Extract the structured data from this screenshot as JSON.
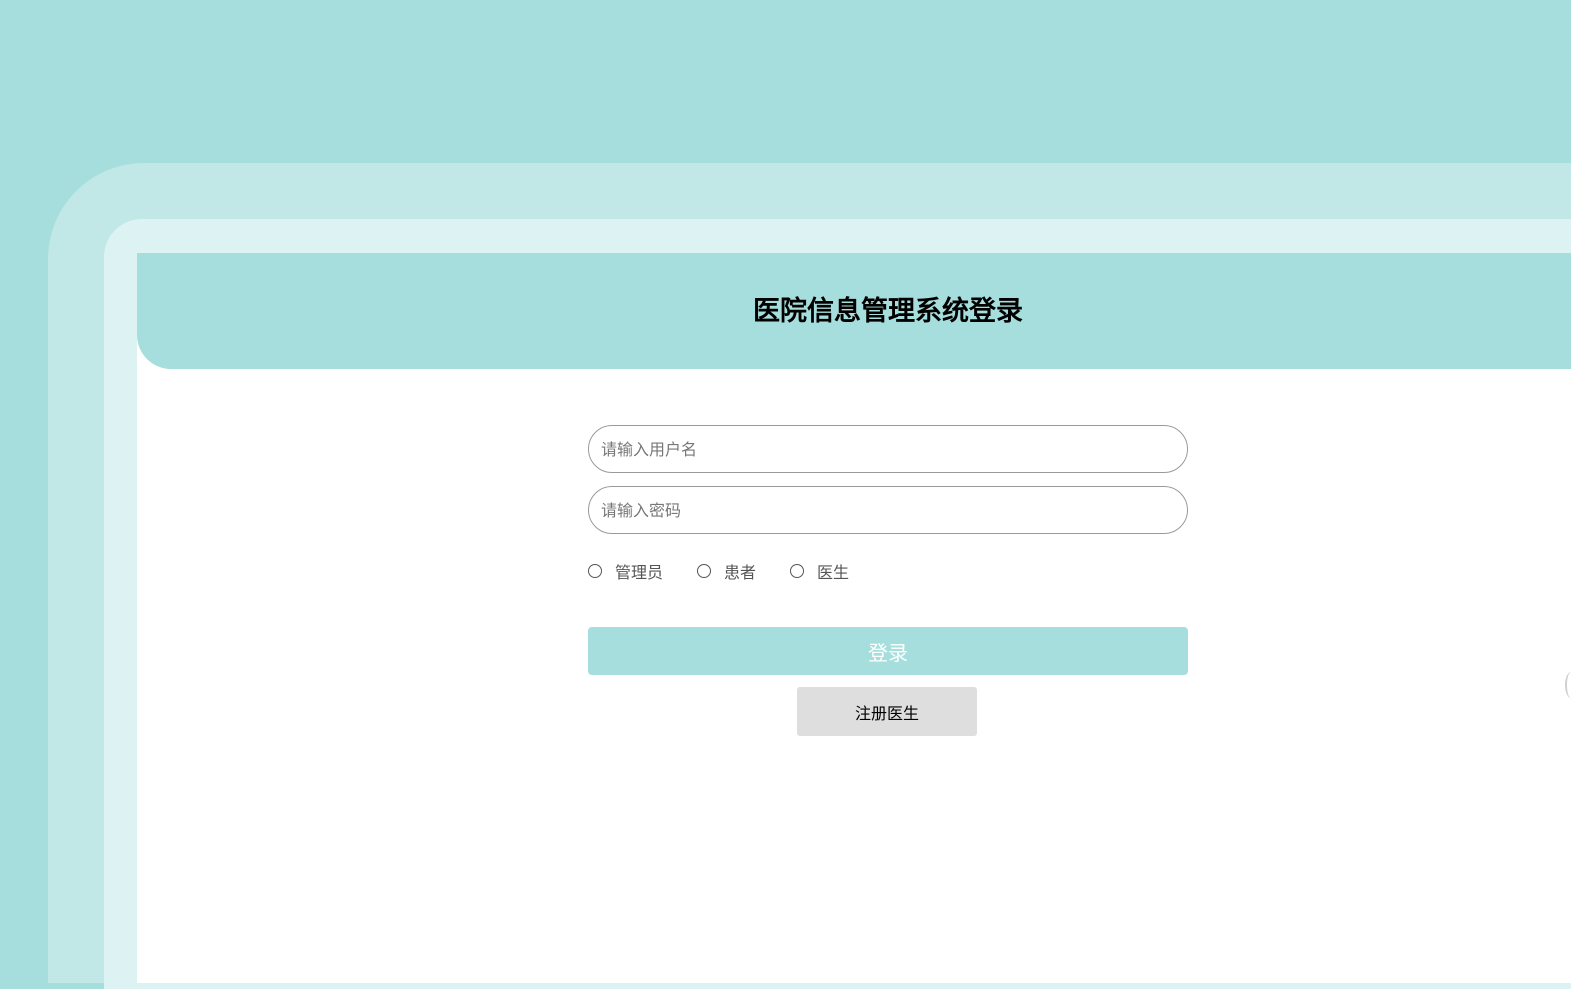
{
  "header": {
    "title": "医院信息管理系统登录"
  },
  "form": {
    "username_placeholder": "请输入用户名",
    "password_placeholder": "请输入密码",
    "roles": [
      {
        "label": "管理员"
      },
      {
        "label": "患者"
      },
      {
        "label": "医生"
      }
    ],
    "login_label": "登录",
    "register_label": "注册医生"
  },
  "colors": {
    "accent": "#a6dedd",
    "frame_outer": "#c1e7e7",
    "frame_inner": "#ddf2f3",
    "register_button_bg": "#dedede"
  }
}
